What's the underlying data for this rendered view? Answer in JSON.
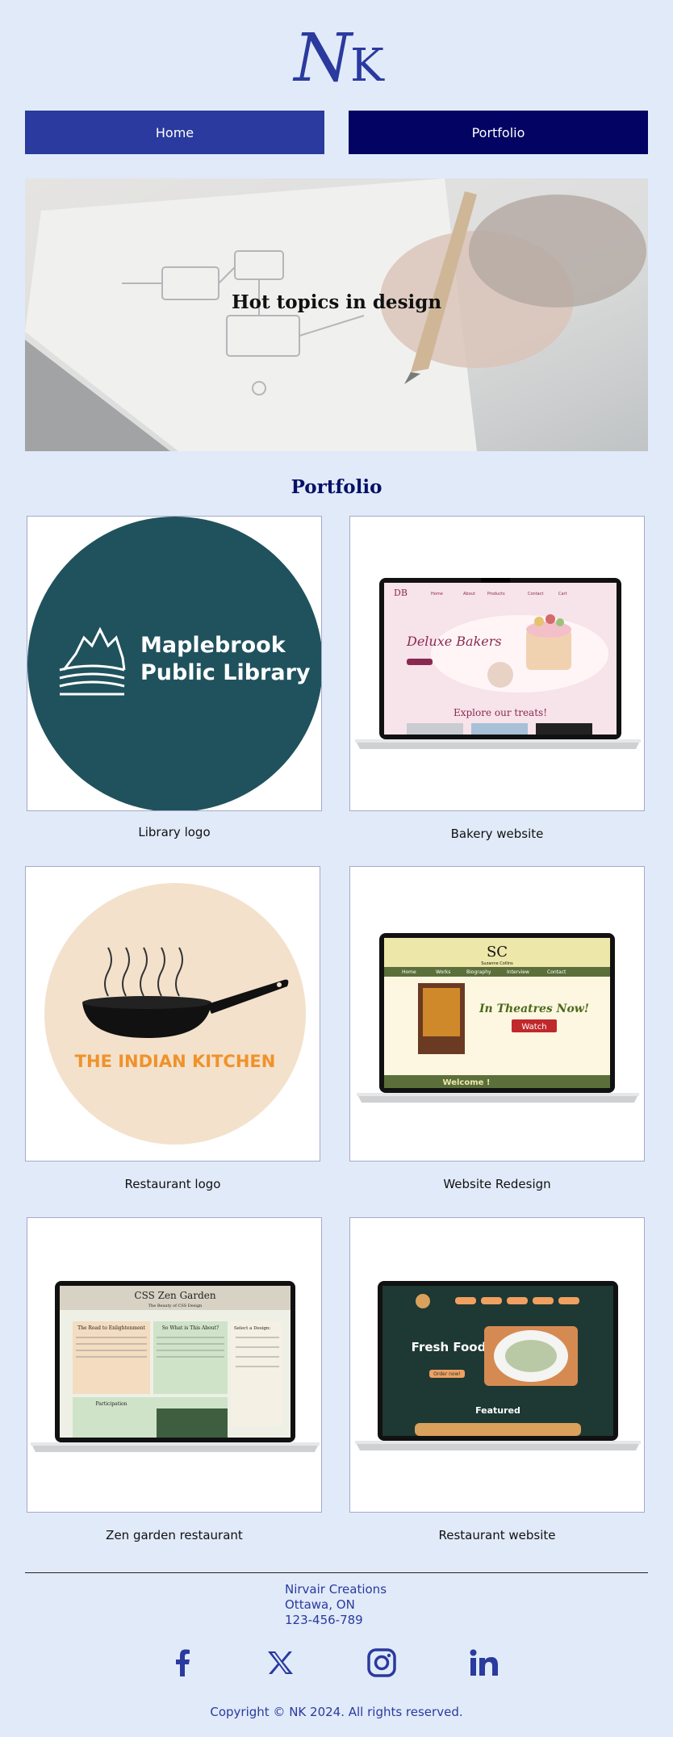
{
  "brand": {
    "logo_text_main": "N",
    "logo_text_k": "K"
  },
  "nav": {
    "home_label": "Home",
    "portfolio_label": "Portfolio"
  },
  "hero": {
    "title": "Hot topics in design"
  },
  "portfolio": {
    "heading": "Portfolio",
    "items": [
      {
        "label": "Library logo",
        "library_line1": "Maplebrook",
        "library_line2": "Public Library"
      },
      {
        "label": "Bakery website",
        "mock_brand": "DB",
        "mock_title": "Deluxe Bakers",
        "mock_sub": "Explore our treats!",
        "mock_nav": [
          "Home",
          "About",
          "Products",
          "Contact",
          "Cart"
        ]
      },
      {
        "label": "Restaurant logo",
        "brand_line": "THE INDIAN KITCHEN"
      },
      {
        "label": "Website Redesign",
        "mock_brand": "SC",
        "mock_brand_sub": "Suzanne Collins",
        "mock_nav": [
          "Home",
          "Works",
          "Biography",
          "Interview",
          "Contact"
        ],
        "mock_heading": "In Theatres Now!",
        "mock_button": "Watch",
        "mock_welcome": "Welcome !"
      },
      {
        "label": "Zen garden restaurant",
        "mock_title": "CSS Zen Garden",
        "mock_sub": "The Beauty of CSS Design",
        "mock_panel1": "The Road to Enlightenment",
        "mock_panel2": "So What is This About?",
        "mock_panel3": "Participation",
        "mock_sidebar": "Select a Design:"
      },
      {
        "label": "Restaurant website",
        "mock_title": "Fresh Food",
        "mock_sub": "Order now!",
        "mock_featured": "Featured"
      }
    ]
  },
  "footer": {
    "company": "Nirvair Creations",
    "city": "Ottawa, ON",
    "phone": "123-456-789",
    "copyright": "Copyright © NK 2024. All rights reserved.",
    "social_icons": [
      "facebook-icon",
      "x-icon",
      "instagram-icon",
      "linkedin-icon"
    ]
  },
  "colors": {
    "page_bg": "#e1eaf9",
    "nav_home": "#2a3a9e",
    "nav_portfolio": "#020363",
    "heading": "#061067",
    "library_teal": "#1f525d",
    "footer_text": "#2a3a9e"
  }
}
